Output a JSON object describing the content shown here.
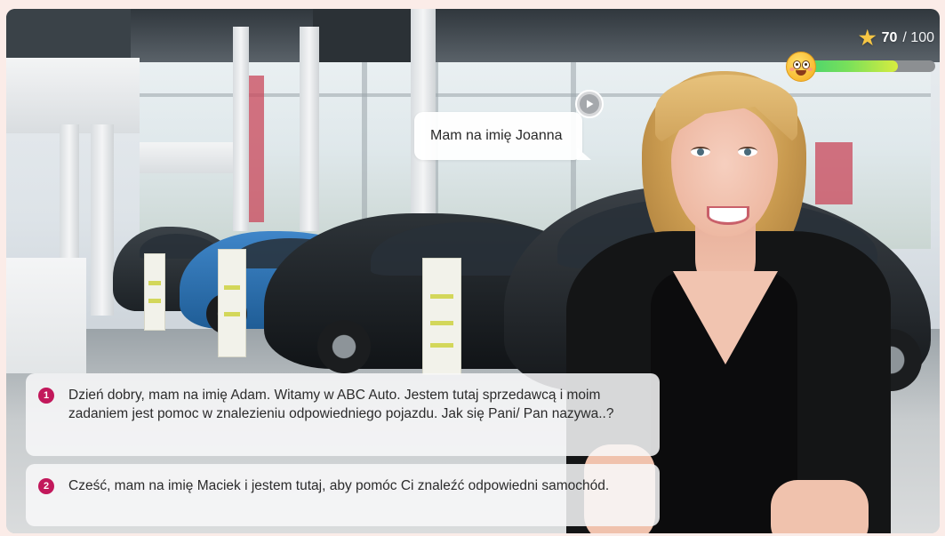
{
  "score": {
    "value": "70",
    "max": "/ 100",
    "fraction": 0.73,
    "star_icon": "star-icon",
    "mood_icon": "smiling-emoji-icon",
    "bar_colors": [
      "#3fd174",
      "#d8ec3f"
    ]
  },
  "speech": {
    "text": "Mam na imię Joanna",
    "play_icon": "play-icon"
  },
  "options": [
    {
      "number": "1",
      "text": "Dzień dobry, mam na imię Adam. Witamy w ABC Auto. Jestem tutaj sprzedawcą i moim zadaniem jest pomoc w znalezieniu odpowiedniego pojazdu. Jak się Pani/ Pan nazywa..?"
    },
    {
      "number": "2",
      "text": "Cześć, mam na imię Maciek i jestem tutaj, aby pomóc Ci znaleźć odpowiedni samochód."
    }
  ],
  "colors": {
    "accent": "#c2185b",
    "page_background": "#fbece8"
  }
}
